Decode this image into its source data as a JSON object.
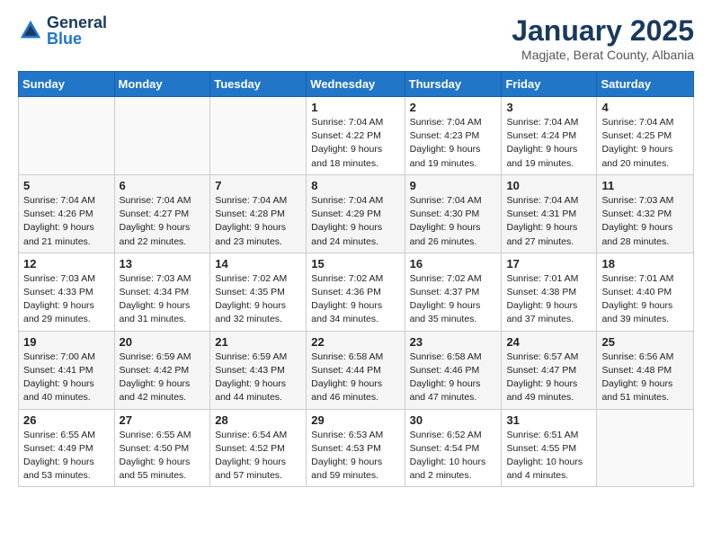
{
  "header": {
    "logo_general": "General",
    "logo_blue": "Blue",
    "month_title": "January 2025",
    "location": "Magjate, Berat County, Albania"
  },
  "weekdays": [
    "Sunday",
    "Monday",
    "Tuesday",
    "Wednesday",
    "Thursday",
    "Friday",
    "Saturday"
  ],
  "weeks": [
    [
      {
        "day": "",
        "info": ""
      },
      {
        "day": "",
        "info": ""
      },
      {
        "day": "",
        "info": ""
      },
      {
        "day": "1",
        "info": "Sunrise: 7:04 AM\nSunset: 4:22 PM\nDaylight: 9 hours\nand 18 minutes."
      },
      {
        "day": "2",
        "info": "Sunrise: 7:04 AM\nSunset: 4:23 PM\nDaylight: 9 hours\nand 19 minutes."
      },
      {
        "day": "3",
        "info": "Sunrise: 7:04 AM\nSunset: 4:24 PM\nDaylight: 9 hours\nand 19 minutes."
      },
      {
        "day": "4",
        "info": "Sunrise: 7:04 AM\nSunset: 4:25 PM\nDaylight: 9 hours\nand 20 minutes."
      }
    ],
    [
      {
        "day": "5",
        "info": "Sunrise: 7:04 AM\nSunset: 4:26 PM\nDaylight: 9 hours\nand 21 minutes."
      },
      {
        "day": "6",
        "info": "Sunrise: 7:04 AM\nSunset: 4:27 PM\nDaylight: 9 hours\nand 22 minutes."
      },
      {
        "day": "7",
        "info": "Sunrise: 7:04 AM\nSunset: 4:28 PM\nDaylight: 9 hours\nand 23 minutes."
      },
      {
        "day": "8",
        "info": "Sunrise: 7:04 AM\nSunset: 4:29 PM\nDaylight: 9 hours\nand 24 minutes."
      },
      {
        "day": "9",
        "info": "Sunrise: 7:04 AM\nSunset: 4:30 PM\nDaylight: 9 hours\nand 26 minutes."
      },
      {
        "day": "10",
        "info": "Sunrise: 7:04 AM\nSunset: 4:31 PM\nDaylight: 9 hours\nand 27 minutes."
      },
      {
        "day": "11",
        "info": "Sunrise: 7:03 AM\nSunset: 4:32 PM\nDaylight: 9 hours\nand 28 minutes."
      }
    ],
    [
      {
        "day": "12",
        "info": "Sunrise: 7:03 AM\nSunset: 4:33 PM\nDaylight: 9 hours\nand 29 minutes."
      },
      {
        "day": "13",
        "info": "Sunrise: 7:03 AM\nSunset: 4:34 PM\nDaylight: 9 hours\nand 31 minutes."
      },
      {
        "day": "14",
        "info": "Sunrise: 7:02 AM\nSunset: 4:35 PM\nDaylight: 9 hours\nand 32 minutes."
      },
      {
        "day": "15",
        "info": "Sunrise: 7:02 AM\nSunset: 4:36 PM\nDaylight: 9 hours\nand 34 minutes."
      },
      {
        "day": "16",
        "info": "Sunrise: 7:02 AM\nSunset: 4:37 PM\nDaylight: 9 hours\nand 35 minutes."
      },
      {
        "day": "17",
        "info": "Sunrise: 7:01 AM\nSunset: 4:38 PM\nDaylight: 9 hours\nand 37 minutes."
      },
      {
        "day": "18",
        "info": "Sunrise: 7:01 AM\nSunset: 4:40 PM\nDaylight: 9 hours\nand 39 minutes."
      }
    ],
    [
      {
        "day": "19",
        "info": "Sunrise: 7:00 AM\nSunset: 4:41 PM\nDaylight: 9 hours\nand 40 minutes."
      },
      {
        "day": "20",
        "info": "Sunrise: 6:59 AM\nSunset: 4:42 PM\nDaylight: 9 hours\nand 42 minutes."
      },
      {
        "day": "21",
        "info": "Sunrise: 6:59 AM\nSunset: 4:43 PM\nDaylight: 9 hours\nand 44 minutes."
      },
      {
        "day": "22",
        "info": "Sunrise: 6:58 AM\nSunset: 4:44 PM\nDaylight: 9 hours\nand 46 minutes."
      },
      {
        "day": "23",
        "info": "Sunrise: 6:58 AM\nSunset: 4:46 PM\nDaylight: 9 hours\nand 47 minutes."
      },
      {
        "day": "24",
        "info": "Sunrise: 6:57 AM\nSunset: 4:47 PM\nDaylight: 9 hours\nand 49 minutes."
      },
      {
        "day": "25",
        "info": "Sunrise: 6:56 AM\nSunset: 4:48 PM\nDaylight: 9 hours\nand 51 minutes."
      }
    ],
    [
      {
        "day": "26",
        "info": "Sunrise: 6:55 AM\nSunset: 4:49 PM\nDaylight: 9 hours\nand 53 minutes."
      },
      {
        "day": "27",
        "info": "Sunrise: 6:55 AM\nSunset: 4:50 PM\nDaylight: 9 hours\nand 55 minutes."
      },
      {
        "day": "28",
        "info": "Sunrise: 6:54 AM\nSunset: 4:52 PM\nDaylight: 9 hours\nand 57 minutes."
      },
      {
        "day": "29",
        "info": "Sunrise: 6:53 AM\nSunset: 4:53 PM\nDaylight: 9 hours\nand 59 minutes."
      },
      {
        "day": "30",
        "info": "Sunrise: 6:52 AM\nSunset: 4:54 PM\nDaylight: 10 hours\nand 2 minutes."
      },
      {
        "day": "31",
        "info": "Sunrise: 6:51 AM\nSunset: 4:55 PM\nDaylight: 10 hours\nand 4 minutes."
      },
      {
        "day": "",
        "info": ""
      }
    ]
  ]
}
